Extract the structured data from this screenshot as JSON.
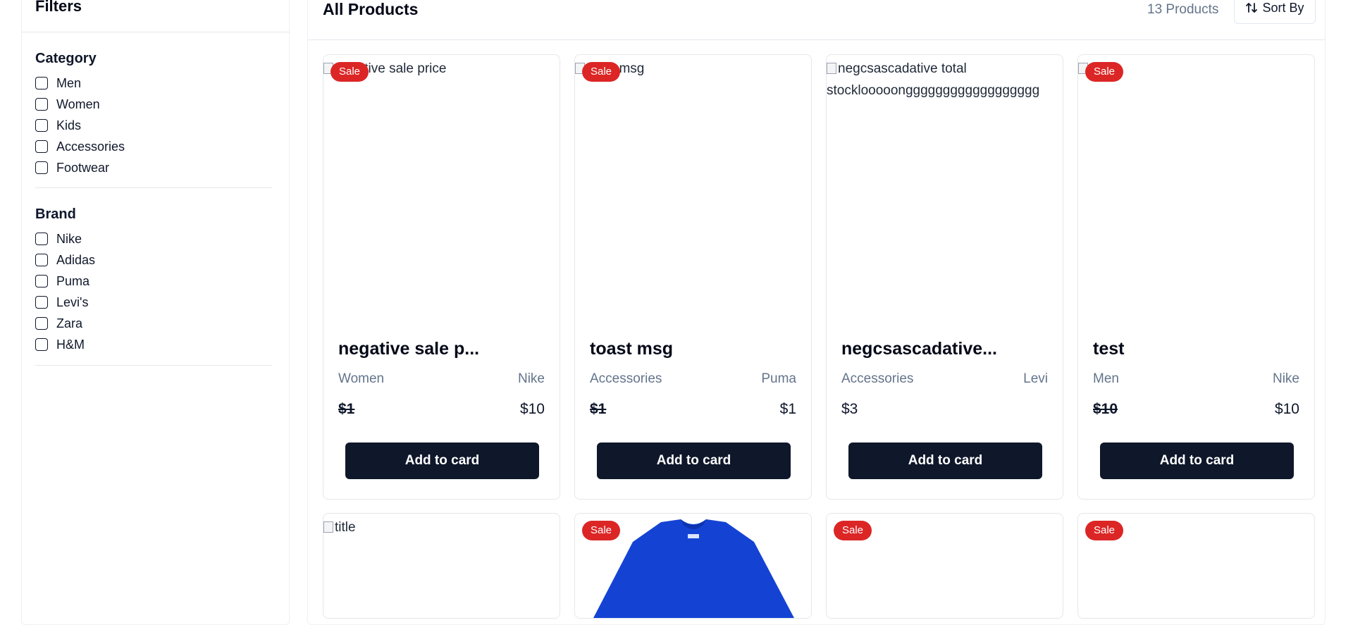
{
  "sidebar": {
    "title": "Filters",
    "groups": [
      {
        "title": "Category",
        "options": [
          "Men",
          "Women",
          "Kids",
          "Accessories",
          "Footwear"
        ]
      },
      {
        "title": "Brand",
        "options": [
          "Nike",
          "Adidas",
          "Puma",
          "Levi's",
          "Zara",
          "H&M"
        ]
      }
    ]
  },
  "header": {
    "title": "All Products",
    "count": "13 Products",
    "sort_label": "Sort By"
  },
  "products": [
    {
      "alt": "negative sale price",
      "sale": "Sale",
      "name": "negative sale p...",
      "category": "Women",
      "brand": "Nike",
      "old_price": "$1",
      "price": "$10",
      "button": "Add to card"
    },
    {
      "alt": "toast msg",
      "sale": "Sale",
      "name": "toast msg",
      "category": "Accessories",
      "brand": "Puma",
      "old_price": "$1",
      "price": "$1",
      "button": "Add to card"
    },
    {
      "alt_line1": "negcsascadative total",
      "alt_line2": "stocklooooongggggggggggggggggg",
      "name": "negcsascadative...",
      "category": "Accessories",
      "brand": "Levi",
      "price": "$3",
      "button": "Add to card"
    },
    {
      "sale": "Sale",
      "name": "test",
      "category": "Men",
      "brand": "Nike",
      "old_price": "$10",
      "price": "$10",
      "button": "Add to card"
    },
    {
      "alt": "title"
    },
    {
      "sale": "Sale",
      "image": "blue-tshirt"
    },
    {
      "sale": "Sale"
    },
    {
      "sale": "Sale"
    }
  ],
  "colors": {
    "primary": "#0f172a",
    "sale": "#dc2626",
    "muted": "#64748b",
    "shirt": "#1443d4"
  }
}
